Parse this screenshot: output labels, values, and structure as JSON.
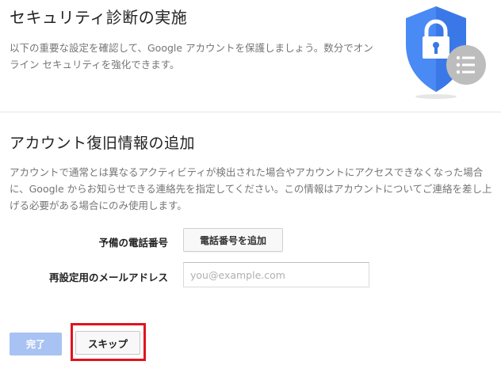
{
  "header": {
    "title": "セキュリティ診断の実施",
    "description": "以下の重要な設定を確認して、Google アカウントを保護しましょう。数分でオンライン セキュリティを強化できます。",
    "illustration_icon": "security-shield-lock-icon"
  },
  "recovery": {
    "title": "アカウント復旧情報の追加",
    "description": "アカウントで通常とは異なるアクティビティが検出された場合やアカウントにアクセスできなくなった場合に、Google からお知らせできる連絡先を指定してください。この情報はアカウントについてご連絡を差し上げる必要がある場合にのみ使用します。",
    "phone_label": "予備の電話番号",
    "add_phone_button": "電話番号を追加",
    "email_label": "再設定用のメールアドレス",
    "email_value": "",
    "email_placeholder": "you@example.com"
  },
  "actions": {
    "done_label": "完了",
    "skip_label": "スキップ"
  },
  "colors": {
    "shield_blue": "#4a8af4",
    "shield_dark": "#3b78e7",
    "done_button_disabled": "#a8c3f3",
    "highlight_red": "#e0141e",
    "badge_gray": "#bdbdbd"
  }
}
